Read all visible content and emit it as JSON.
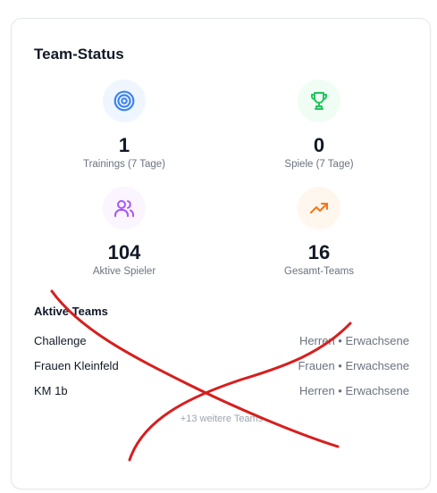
{
  "card": {
    "title": "Team-Status"
  },
  "stats": [
    {
      "value": "1",
      "label": "Trainings (7 Tage)",
      "icon": "target-icon",
      "color": "#3b82f6",
      "bg": "#eff6ff"
    },
    {
      "value": "0",
      "label": "Spiele (7 Tage)",
      "icon": "trophy-icon",
      "color": "#22c55e",
      "bg": "#f0fdf4"
    },
    {
      "value": "104",
      "label": "Aktive Spieler",
      "icon": "users-icon",
      "color": "#a855f7",
      "bg": "#faf5ff"
    },
    {
      "value": "16",
      "label": "Gesamt-Teams",
      "icon": "trending-up-icon",
      "color": "#f97316",
      "bg": "#fff7ed"
    }
  ],
  "active_teams": {
    "title": "Aktive Teams",
    "teams": [
      {
        "name": "Challenge",
        "meta": "Herren • Erwachsene"
      },
      {
        "name": "Frauen Kleinfeld",
        "meta": "Frauen • Erwachsene"
      },
      {
        "name": "KM 1b",
        "meta": "Herren • Erwachsene"
      }
    ],
    "more": "+13 weitere Teams"
  },
  "annotation": {
    "type": "red-x-scribble",
    "color": "#d61f1f"
  }
}
